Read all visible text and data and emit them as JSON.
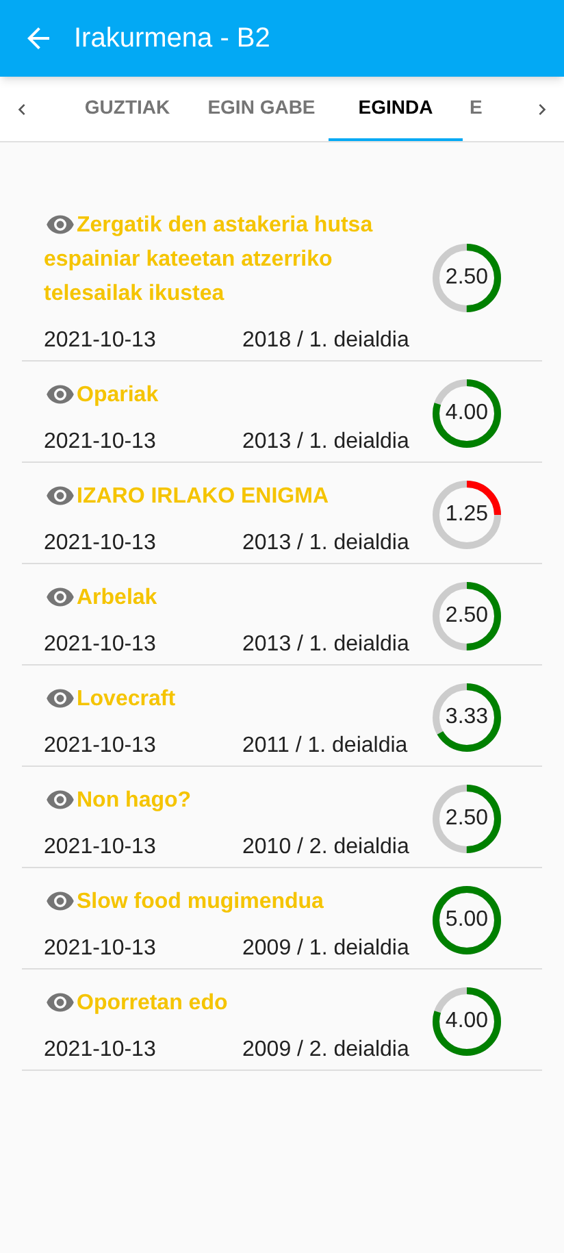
{
  "app_bar": {
    "title": "Irakurmena - B2"
  },
  "tabs": [
    {
      "label": "GUZTIAK",
      "selected": false
    },
    {
      "label": "EGIN GABE",
      "selected": false
    },
    {
      "label": "EGINDA",
      "selected": true
    },
    {
      "label": "E",
      "selected": false
    }
  ],
  "items": [
    {
      "title": "Zergatik den astakeria hutsa espainiar kateetan atzerriko telesailak ikustea",
      "date": "2021-10-13",
      "exam": "2018 / 1. deialdia",
      "score": "2.50",
      "level": 0.5
    },
    {
      "title": "Opariak",
      "date": "2021-10-13",
      "exam": "2013 / 1. deialdia",
      "score": "4.00",
      "level": 0.8
    },
    {
      "title": "IZARO IRLAKO ENIGMA",
      "date": "2021-10-13",
      "exam": "2013 / 1. deialdia",
      "score": "1.25",
      "level": 0.25
    },
    {
      "title": "Arbelak",
      "date": "2021-10-13",
      "exam": "2013 / 1. deialdia",
      "score": "2.50",
      "level": 0.5
    },
    {
      "title": "Lovecraft",
      "date": "2021-10-13",
      "exam": "2011 / 1. deialdia",
      "score": "3.33",
      "level": 0.666
    },
    {
      "title": "Non hago?",
      "date": "2021-10-13",
      "exam": "2010 / 2. deialdia",
      "score": "2.50",
      "level": 0.5
    },
    {
      "title": "Slow food mugimendua",
      "date": "2021-10-13",
      "exam": "2009 / 1. deialdia",
      "score": "5.00",
      "level": 1
    },
    {
      "title": "Oporretan edo",
      "date": "2021-10-13",
      "exam": "2009 / 2. deialdia",
      "score": "4.00",
      "level": 0.8
    }
  ]
}
